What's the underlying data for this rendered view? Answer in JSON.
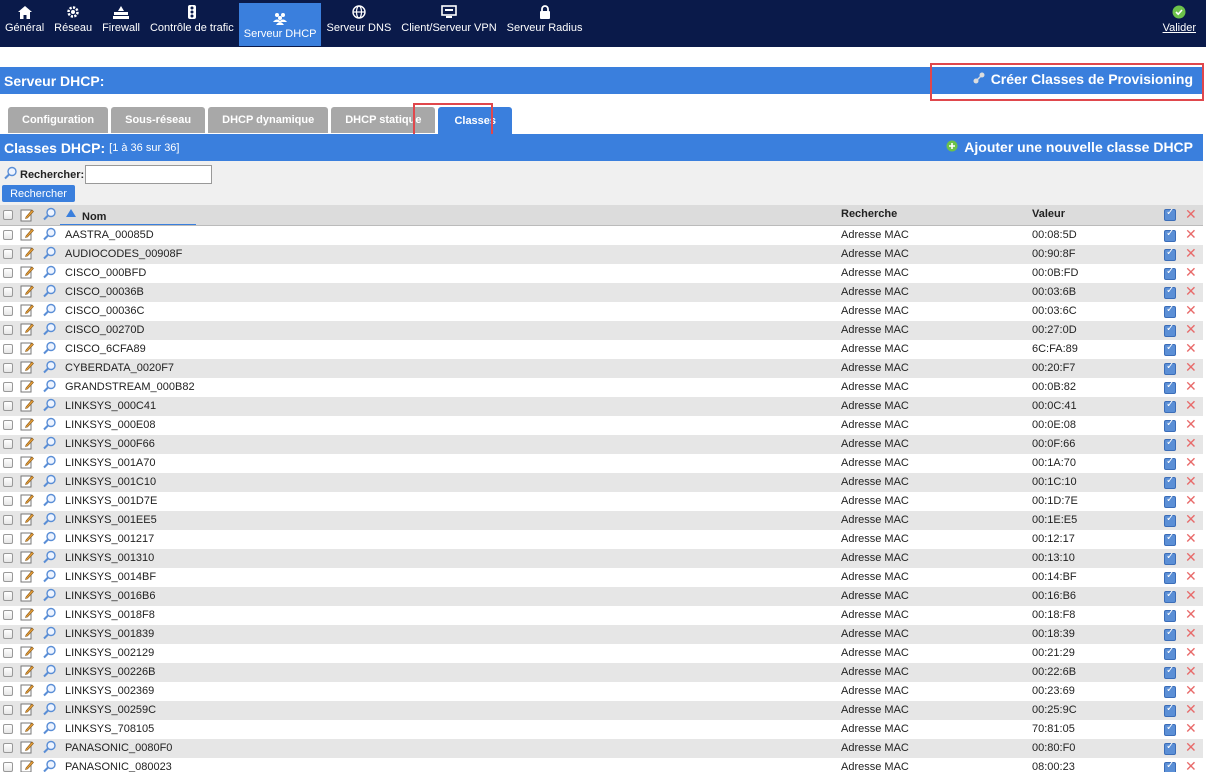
{
  "nav": {
    "items": [
      {
        "label": "Général",
        "icon": "home-icon",
        "active": false
      },
      {
        "label": "Réseau",
        "icon": "gear-icon",
        "active": false
      },
      {
        "label": "Firewall",
        "icon": "firewall-icon",
        "active": false
      },
      {
        "label": "Contrôle de trafic",
        "icon": "traffic-light-icon",
        "active": false
      },
      {
        "label": "Serveur DHCP",
        "icon": "users-icon",
        "active": true
      },
      {
        "label": "Serveur DNS",
        "icon": "globe-icon",
        "active": false
      },
      {
        "label": "Client/Serveur VPN",
        "icon": "monitor-icon",
        "active": false
      },
      {
        "label": "Serveur Radius",
        "icon": "lock-icon",
        "active": false
      }
    ],
    "valider_label": "Valider"
  },
  "section": {
    "title": "Serveur DHCP:",
    "provisioning_label": "Créer Classes de Provisioning"
  },
  "tabs": [
    {
      "label": "Configuration",
      "active": false
    },
    {
      "label": "Sous-réseau",
      "active": false
    },
    {
      "label": "DHCP dynamique",
      "active": false
    },
    {
      "label": "DHCP statique",
      "active": false
    },
    {
      "label": "Classes",
      "active": true
    }
  ],
  "classes": {
    "title": "Classes DHCP:",
    "count": "[1 à 36 sur 36]",
    "add_label": "Ajouter une nouvelle classe DHCP"
  },
  "search": {
    "label": "Rechercher:",
    "value": "",
    "button_label": "Rechercher"
  },
  "table": {
    "headers": {
      "name": "Nom",
      "search": "Recherche",
      "value": "Valeur"
    },
    "rows": [
      {
        "name": "AASTRA_00085D",
        "search": "Adresse MAC",
        "value": "00:08:5D"
      },
      {
        "name": "AUDIOCODES_00908F",
        "search": "Adresse MAC",
        "value": "00:90:8F"
      },
      {
        "name": "CISCO_000BFD",
        "search": "Adresse MAC",
        "value": "00:0B:FD"
      },
      {
        "name": "CISCO_00036B",
        "search": "Adresse MAC",
        "value": "00:03:6B"
      },
      {
        "name": "CISCO_00036C",
        "search": "Adresse MAC",
        "value": "00:03:6C"
      },
      {
        "name": "CISCO_00270D",
        "search": "Adresse MAC",
        "value": "00:27:0D"
      },
      {
        "name": "CISCO_6CFA89",
        "search": "Adresse MAC",
        "value": "6C:FA:89"
      },
      {
        "name": "CYBERDATA_0020F7",
        "search": "Adresse MAC",
        "value": "00:20:F7"
      },
      {
        "name": "GRANDSTREAM_000B82",
        "search": "Adresse MAC",
        "value": "00:0B:82"
      },
      {
        "name": "LINKSYS_000C41",
        "search": "Adresse MAC",
        "value": "00:0C:41"
      },
      {
        "name": "LINKSYS_000E08",
        "search": "Adresse MAC",
        "value": "00:0E:08"
      },
      {
        "name": "LINKSYS_000F66",
        "search": "Adresse MAC",
        "value": "00:0F:66"
      },
      {
        "name": "LINKSYS_001A70",
        "search": "Adresse MAC",
        "value": "00:1A:70"
      },
      {
        "name": "LINKSYS_001C10",
        "search": "Adresse MAC",
        "value": "00:1C:10"
      },
      {
        "name": "LINKSYS_001D7E",
        "search": "Adresse MAC",
        "value": "00:1D:7E"
      },
      {
        "name": "LINKSYS_001EE5",
        "search": "Adresse MAC",
        "value": "00:1E:E5"
      },
      {
        "name": "LINKSYS_001217",
        "search": "Adresse MAC",
        "value": "00:12:17"
      },
      {
        "name": "LINKSYS_001310",
        "search": "Adresse MAC",
        "value": "00:13:10"
      },
      {
        "name": "LINKSYS_0014BF",
        "search": "Adresse MAC",
        "value": "00:14:BF"
      },
      {
        "name": "LINKSYS_0016B6",
        "search": "Adresse MAC",
        "value": "00:16:B6"
      },
      {
        "name": "LINKSYS_0018F8",
        "search": "Adresse MAC",
        "value": "00:18:F8"
      },
      {
        "name": "LINKSYS_001839",
        "search": "Adresse MAC",
        "value": "00:18:39"
      },
      {
        "name": "LINKSYS_002129",
        "search": "Adresse MAC",
        "value": "00:21:29"
      },
      {
        "name": "LINKSYS_00226B",
        "search": "Adresse MAC",
        "value": "00:22:6B"
      },
      {
        "name": "LINKSYS_002369",
        "search": "Adresse MAC",
        "value": "00:23:69"
      },
      {
        "name": "LINKSYS_00259C",
        "search": "Adresse MAC",
        "value": "00:25:9C"
      },
      {
        "name": "LINKSYS_708105",
        "search": "Adresse MAC",
        "value": "70:81:05"
      },
      {
        "name": "PANASONIC_0080F0",
        "search": "Adresse MAC",
        "value": "00:80:F0"
      },
      {
        "name": "PANASONIC_080023",
        "search": "Adresse MAC",
        "value": "08:00:23"
      }
    ]
  },
  "colors": {
    "nav_bg": "#0a1a4a",
    "accent": "#3a7fdd",
    "tab_inactive": "#a8a8a8",
    "highlight": "#e0474c",
    "delete": "#e86a6a"
  }
}
